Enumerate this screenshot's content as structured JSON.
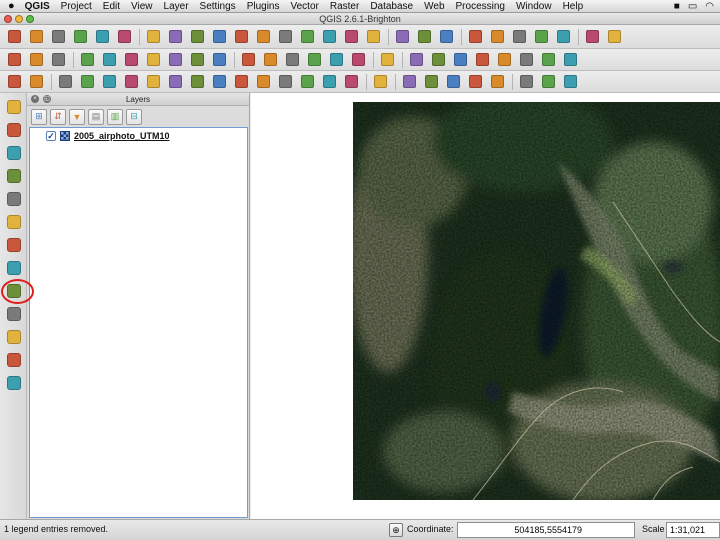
{
  "menubar": {
    "apple_icon": "apple-icon",
    "items": [
      "QGIS",
      "Project",
      "Edit",
      "View",
      "Layer",
      "Settings",
      "Plugins",
      "Vector",
      "Raster",
      "Database",
      "Web",
      "Processing",
      "Window",
      "Help"
    ]
  },
  "window": {
    "title": "QGIS 2.6.1-Brighton",
    "light_colors": [
      "#ee5b52",
      "#f4b73a",
      "#58c143"
    ]
  },
  "toolbars": {
    "row1_icons": [
      "new-project-icon",
      "open-project-icon",
      "save-project-icon",
      "save-as-icon",
      "new-print-composer-icon",
      "composer-manager-icon",
      "pan-icon",
      "pan-to-selection-icon",
      "zoom-in-icon",
      "zoom-out-icon",
      "zoom-native-icon",
      "zoom-full-icon",
      "zoom-to-selection-icon",
      "zoom-to-layer-icon",
      "zoom-last-icon",
      "zoom-next-icon",
      "refresh-icon",
      "identify-icon",
      "select-features-icon",
      "deselect-icon",
      "measure-icon",
      "attribute-table-icon",
      "statistics-icon",
      "map-tips-icon",
      "new-bookmark-icon",
      "show-bookmarks-icon",
      "text-annotation-icon"
    ],
    "row2_icons": [
      "current-edits-icon",
      "toggle-editing-icon",
      "save-layer-edits-icon",
      "add-feature-icon",
      "move-feature-icon",
      "node-tool-icon",
      "delete-selected-icon",
      "cut-features-icon",
      "copy-features-icon",
      "paste-features-icon",
      "label-icon",
      "pin-labels-icon",
      "show-hide-labels-icon",
      "move-label-icon",
      "rotate-label-icon",
      "change-label-icon",
      "csw-icon",
      "python-console-icon",
      "processing-toolbox-icon",
      "graphical-modeler-icon",
      "georeferencer-icon",
      "gps-icon",
      "coordinate-capture-icon",
      "grid-icon",
      "heatmap-icon"
    ],
    "row3_icons": [
      "undo-icon",
      "redo-icon",
      "simplify-feature-icon",
      "add-ring-icon",
      "add-part-icon",
      "fill-ring-icon",
      "delete-ring-icon",
      "delete-part-icon",
      "reshape-features-icon",
      "offset-curve-icon",
      "split-features-icon",
      "split-parts-icon",
      "merge-selected-icon",
      "merge-attributes-icon",
      "rotate-point-symbols-icon",
      "rotate-feature-icon",
      "csw-icon",
      "digitize-icon",
      "new-spatialite-layer-icon",
      "add-delimited-text-icon",
      "new-gpx-icon",
      "new-shapefile-icon",
      "topology-checker-icon",
      "road-graph-icon",
      "interpolation-icon"
    ]
  },
  "left_toolbar": {
    "icons": [
      "add-vector-layer-icon",
      "add-raster-layer-icon",
      "add-postgis-layer-icon",
      "add-spatialite-layer-icon",
      "add-mssql-layer-icon",
      "add-oracle-layer-icon",
      "add-wms-layer-icon",
      "add-wcs-layer-icon",
      "add-wfs-layer-icon",
      "add-delimited-text-layer-icon",
      "new-shapefile-layer-icon",
      "add-virtual-layer-icon",
      "add-gps-layer-icon"
    ]
  },
  "layers_panel": {
    "title": "Layers",
    "tools": [
      "add-group-icon",
      "expand-all-icon",
      "filter-legend-icon",
      "collapse-icon",
      "manage-visibility-icon",
      "remove-layer-icon"
    ],
    "layers": [
      {
        "name": "2005_airphoto_UTM10",
        "checked": true,
        "icon": "raster-layer-icon"
      }
    ]
  },
  "statusbar": {
    "message": "1 legend entries removed.",
    "coordinate_label": "Coordinate:",
    "coordinate_value": "504185,5554179",
    "scale_label": "Scale",
    "scale_value": "1:31,021"
  }
}
